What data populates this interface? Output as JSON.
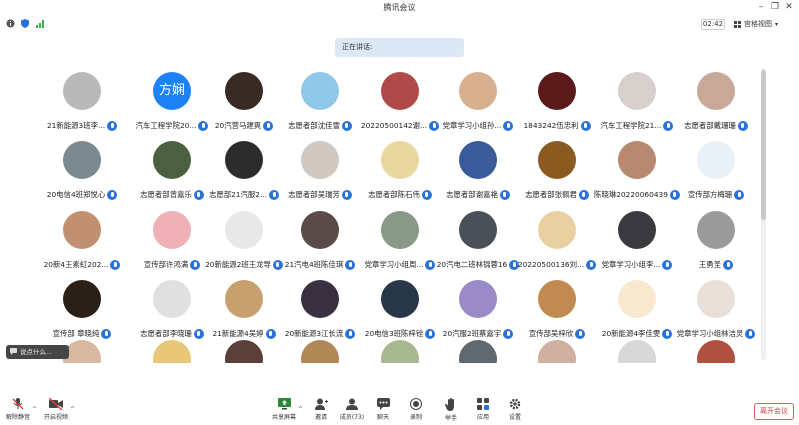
{
  "window": {
    "title": "腾讯会议"
  },
  "info_bar": {
    "elapsed": "02:42",
    "view_label": "宫格视图"
  },
  "speaking_banner": "正在讲话:",
  "colors": {
    "accent": "#2a72d8",
    "leave": "#d93b3b",
    "banner_bg": "#dde8f6"
  },
  "participants": [
    {
      "name": "21新能源3班李...",
      "avatar": "#b9b9b9"
    },
    {
      "name": "汽车工程学院20...",
      "avatar_text": "方娴"
    },
    {
      "name": "20汽营马建爽",
      "avatar": "#3a2a24"
    },
    {
      "name": "志愿者部沈佳雪",
      "avatar": "#8fc8e8"
    },
    {
      "name": "20220500142谢...",
      "avatar": "#b04a4a"
    },
    {
      "name": "党章学习小组孙...",
      "avatar": "#d8b090"
    },
    {
      "name": "1843242伍忠利",
      "avatar": "#5a1a1a"
    },
    {
      "name": "汽车工程学院21...",
      "avatar": "#d8d0cc"
    },
    {
      "name": "志愿者部戴珊珊",
      "avatar": "#c8a898"
    },
    {
      "name": "20电信4班郑悦心",
      "avatar": "#7a8a90"
    },
    {
      "name": "志愿者部曾嘉乐",
      "avatar": "#4a6040"
    },
    {
      "name": "志愿部21汽服2...",
      "avatar": "#2c2c2c"
    },
    {
      "name": "志愿者部吴瑞芳",
      "avatar": "#d0c8c0"
    },
    {
      "name": "志愿者部陈石伟",
      "avatar": "#e8d8a0"
    },
    {
      "name": "志愿者部谢嘉艳",
      "avatar": "#3a5a9a"
    },
    {
      "name": "志愿者部张佩君",
      "avatar": "#8a5a20"
    },
    {
      "name": "陈晓琳20220060439",
      "avatar": "#b88870"
    },
    {
      "name": "宣传部方梅珊",
      "avatar": "#e8f0f8"
    },
    {
      "name": "20新4王素虹202...",
      "avatar": "#c09070"
    },
    {
      "name": "宣传部许鸿满",
      "avatar": "#f0b0b8"
    },
    {
      "name": "20新能源2班王龙导",
      "avatar": "#e8e8e8"
    },
    {
      "name": "21汽电4班陈佳琪",
      "avatar": "#5a4a48"
    },
    {
      "name": "党章学习小组周...",
      "avatar": "#8a9a88"
    },
    {
      "name": "20汽电二班林锦蓉16",
      "avatar": "#4a5058"
    },
    {
      "name": "20220500136刘...",
      "avatar": "#e8d0a0"
    },
    {
      "name": "党章学习小组李...",
      "avatar": "#3a3a40"
    },
    {
      "name": "王勇圣",
      "avatar": "#9a9a9a"
    },
    {
      "name": "宣传部 章晓纯",
      "avatar": "#2a2018"
    },
    {
      "name": "志愿者部李晓珊",
      "avatar": "#e0e0e0"
    },
    {
      "name": "21新能源4吴婷",
      "avatar": "#c8a070"
    },
    {
      "name": "20新能源3江长流",
      "avatar": "#3a3040"
    },
    {
      "name": "20电信3班陈梓铨",
      "avatar": "#283848"
    },
    {
      "name": "20汽服2班蔡嘉宇",
      "avatar": "#9a8ac8"
    },
    {
      "name": "宣传部吴梓欣",
      "avatar": "#c08a50"
    },
    {
      "name": "20新能源4李佳雯",
      "avatar": "#f8e8d0"
    },
    {
      "name": "党章学习小组林洁灵",
      "avatar": "#e8e0d8"
    },
    {
      "name": "",
      "avatar": "#d8b8a0"
    },
    {
      "name": "",
      "avatar": "#e8c878"
    },
    {
      "name": "",
      "avatar": "#5a4038"
    },
    {
      "name": "",
      "avatar": "#b08858"
    },
    {
      "name": "",
      "avatar": "#a8b890"
    },
    {
      "name": "",
      "avatar": "#606870"
    },
    {
      "name": "",
      "avatar": "#d0b0a0"
    },
    {
      "name": "",
      "avatar": "#d8d8d8"
    },
    {
      "name": "",
      "avatar": "#b05040"
    }
  ],
  "chat_hint": "说点什么...",
  "toolbar": {
    "mic_label": "解除静音",
    "video_label": "开启视频",
    "share_label": "共享屏幕",
    "invite_label": "邀请",
    "members_label": "成员(73)",
    "chat_label": "聊天",
    "record_label": "录制",
    "hand_label": "举手",
    "apps_label": "应用",
    "settings_label": "设置",
    "leave_label": "离开会议"
  }
}
